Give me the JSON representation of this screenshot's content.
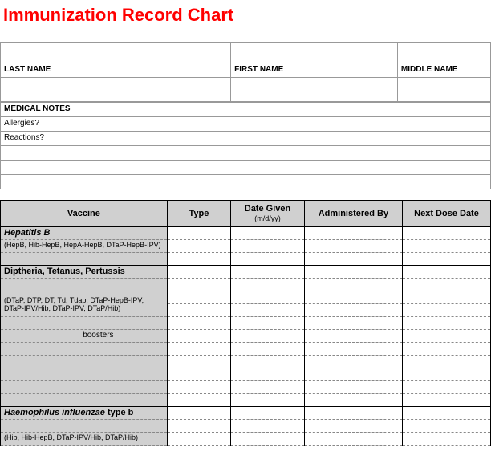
{
  "title": "Immunization Record Chart",
  "labels": {
    "last_name": "LAST NAME",
    "first_name": "FIRST NAME",
    "middle_name": "MIDDLE NAME",
    "medical_notes": "MEDICAL NOTES",
    "allergies": "Allergies?",
    "reactions": "Reactions?"
  },
  "vaccine_headers": {
    "vaccine": "Vaccine",
    "type": "Type",
    "date_given": "Date Given",
    "date_hint": "(m/d/yy)",
    "administered_by": "Administered By",
    "next_dose": "Next Dose Date"
  },
  "vaccines": {
    "hepb": {
      "name": "Hepatitis B",
      "sub": "(HepB, Hib-HepB, HepA-HepB, DTaP-HepB-IPV)"
    },
    "dtp": {
      "name": "Diptheria, Tetanus, Pertussis",
      "sub": "(DTaP, DTP, DT, Td, Tdap, DTaP-HepB-IPV, DTaP-IPV/Hib, DTaP-IPV, DTaP/Hib)",
      "boosters": "boosters"
    },
    "hib": {
      "prefix": "Haemophilus influenzae",
      "suffix": " type b",
      "sub": "(Hib, Hib-HepB, DTaP-IPV/Hib, DTaP/Hib)"
    }
  }
}
